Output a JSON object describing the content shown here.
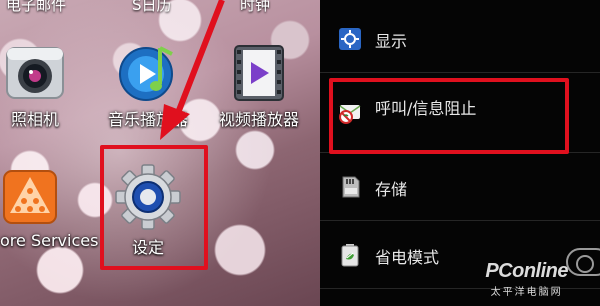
{
  "home": {
    "top_row": [
      "电子邮件",
      "S日历",
      "时钟"
    ],
    "apps": [
      {
        "name": "camera",
        "label": "照相机",
        "icon": "camera-icon"
      },
      {
        "name": "music-player",
        "label": "音乐播放器",
        "icon": "music-icon"
      },
      {
        "name": "video-player",
        "label": "视频播放器",
        "icon": "video-icon"
      },
      {
        "name": "store-services",
        "label": "ore Services",
        "icon": "store-icon"
      },
      {
        "name": "settings",
        "label": "设定",
        "icon": "gear-icon"
      }
    ]
  },
  "settings_list": {
    "items": [
      {
        "label": "显示",
        "icon": "display-icon"
      },
      {
        "label": "呼叫/信息阻止",
        "icon": "call-block-icon"
      },
      {
        "label": "存储",
        "icon": "storage-icon"
      },
      {
        "label": "省电模式",
        "icon": "battery-saver-icon"
      }
    ]
  },
  "watermark": {
    "brand": "PConline",
    "sub": "太平洋电脑网"
  },
  "colors": {
    "highlight": "#e0101e",
    "settings_bg": "#050505"
  }
}
